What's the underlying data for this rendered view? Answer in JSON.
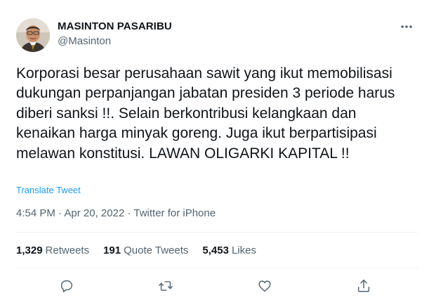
{
  "author": {
    "name": "MASINTON PASARIBU",
    "handle": "@Masinton"
  },
  "tweet": {
    "text": "Korporasi besar perusahaan sawit yang ikut memobilisasi dukungan perpanjangan jabatan presiden 3 periode harus diberi sanksi !!. Selain berkontribusi kelangkaan dan kenaikan harga minyak goreng. Juga ikut berpartisipasi melawan konstitusi. LAWAN OLIGARKI KAPITAL !!",
    "translate_label": "Translate Tweet",
    "time": "4:54 PM",
    "date": "Apr 20, 2022",
    "source": "Twitter for iPhone",
    "separator": " · "
  },
  "stats": {
    "retweets_count": "1,329",
    "retweets_label": "Retweets",
    "quotes_count": "191",
    "quotes_label": "Quote Tweets",
    "likes_count": "5,453",
    "likes_label": "Likes"
  },
  "colors": {
    "accent": "#1d9bf0",
    "text": "#0f1419",
    "secondary": "#536471",
    "divider": "#eff3f4"
  },
  "icons": {
    "more": "more-dots-icon",
    "reply": "reply-icon",
    "retweet": "retweet-icon",
    "like": "heart-icon",
    "share": "share-icon"
  }
}
